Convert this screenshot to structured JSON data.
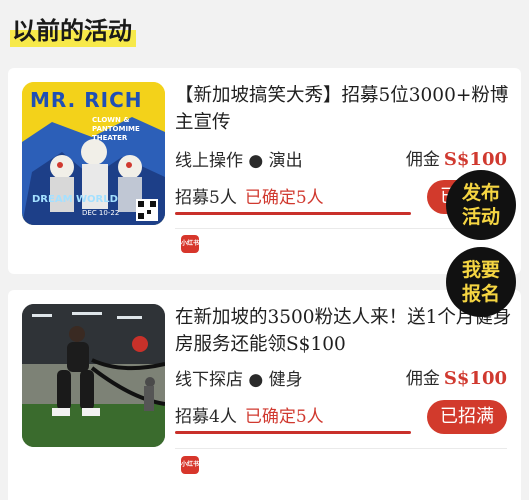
{
  "section_title": "以前的活动",
  "activities": [
    {
      "title": "【新加坡搞笑大秀】招募5位3000+粉博主宣传",
      "meta": "线上操作 ● 演出",
      "fee_label": "佣金",
      "fee_amount": "S$100",
      "recruit": "招募5人",
      "confirmed": "已确定5人",
      "progress": 1.0,
      "button": "已招满",
      "source_badge": "小红书",
      "image_text": {
        "headline": "MR. RICH",
        "subline": "CLOWN & PANTOMIME THEATER",
        "banner": "DREAM WORLD",
        "date": "DEC 10-22"
      }
    },
    {
      "title": "在新加坡的3500粉达人来！送1个月健身房服务还能领S$100",
      "meta": "线下探店 ● 健身",
      "fee_label": "佣金",
      "fee_amount": "S$100",
      "recruit": "招募4人",
      "confirmed": "已确定5人",
      "progress": 1.0,
      "button": "已招满",
      "source_badge": "小红书"
    }
  ],
  "float_buttons": {
    "publish": [
      "发布",
      "活动"
    ],
    "signup": [
      "我要",
      "报名"
    ]
  }
}
